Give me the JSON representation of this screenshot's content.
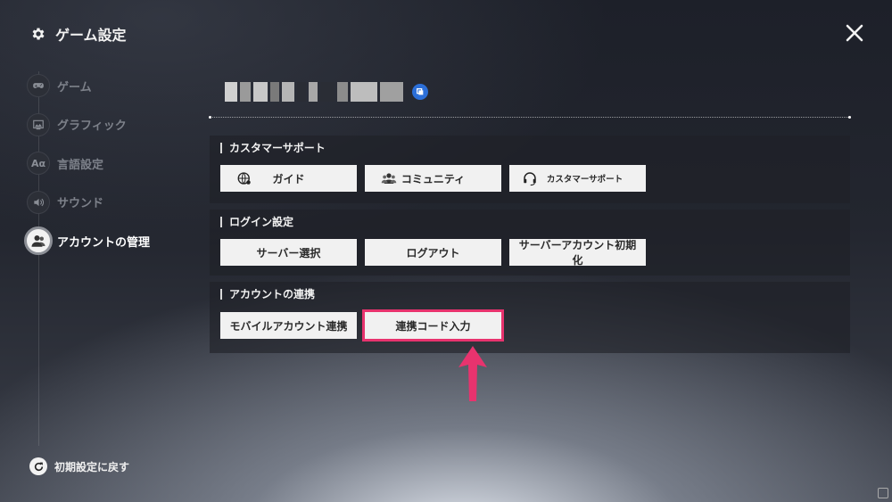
{
  "header": {
    "title": "ゲーム設定"
  },
  "nav": [
    {
      "label": "ゲーム",
      "icon": "gamepad-icon"
    },
    {
      "label": "グラフィック",
      "icon": "image-icon"
    },
    {
      "label": "言語設定",
      "icon": "language-icon",
      "glyph": "Aα"
    },
    {
      "label": "サウンド",
      "icon": "speaker-icon"
    },
    {
      "label": "アカウントの管理",
      "icon": "user-icon",
      "active": true
    }
  ],
  "reset": {
    "label": "初期設定に戻す"
  },
  "sections": {
    "support": {
      "title": "カスタマーサポート",
      "buttons": [
        "ガイド",
        "コミュニティ",
        "カスタマーサポート"
      ]
    },
    "login": {
      "title": "ログイン設定",
      "buttons": [
        "サーバー選択",
        "ログアウト",
        "サーバーアカウント初期化"
      ]
    },
    "link": {
      "title": "アカウントの連携",
      "buttons": [
        "モバイルアカウント連携",
        "連携コード入力"
      ]
    }
  },
  "colors": {
    "highlight": "#e8336e",
    "copy_button": "#2c6fd8"
  }
}
